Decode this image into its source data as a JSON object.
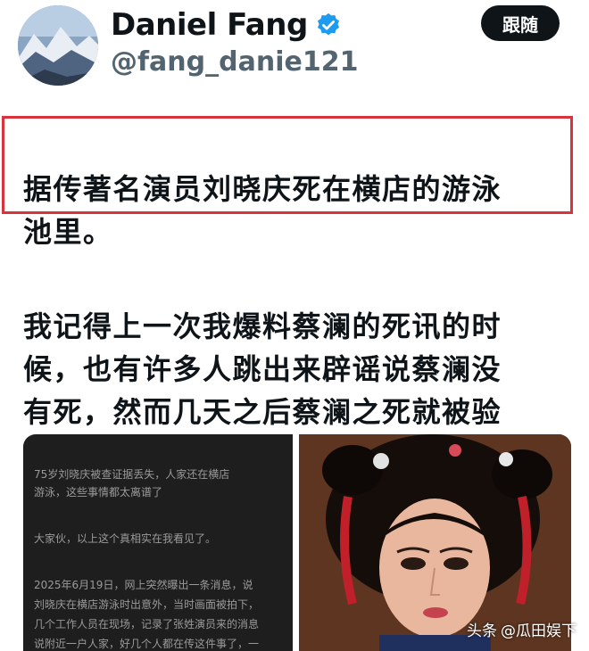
{
  "profile": {
    "display_name": "Daniel Fang",
    "handle": "@fang_danie121",
    "verified_icon": "verified-badge-icon",
    "follow_label": "跟随"
  },
  "tweet": {
    "line1": "据传著名演员刘晓庆死在横店的游泳\n池里。",
    "line2": "我记得上一次我爆料蔡澜的死讯的时\n候，也有许多人跳出来辟谣说蔡澜没\n有死，然而几天之后蔡澜之死就被验\n证了。"
  },
  "media": {
    "document_lines": [
      "75岁刘晓庆被查证据丢失，人家还在横店",
      "游泳，这些事情都太离谱了",
      "大家伙，以上这个真相实在我看见了。",
      "2025年6月19日，网上突然曝出一条消息，说",
      "刘晓庆在横店游泳时出意外，当时画面被拍下，",
      "几个工作人员在现场，记录了张姓演员来的消息",
      "说附近一户人家，好几个人都在传这件事了，一"
    ]
  },
  "watermark": {
    "platform": "头条",
    "account": "@瓜田娱下"
  },
  "colors": {
    "highlight_border": "#d9343b",
    "verified_blue": "#1d9bf0",
    "follow_bg": "#0f1419"
  }
}
